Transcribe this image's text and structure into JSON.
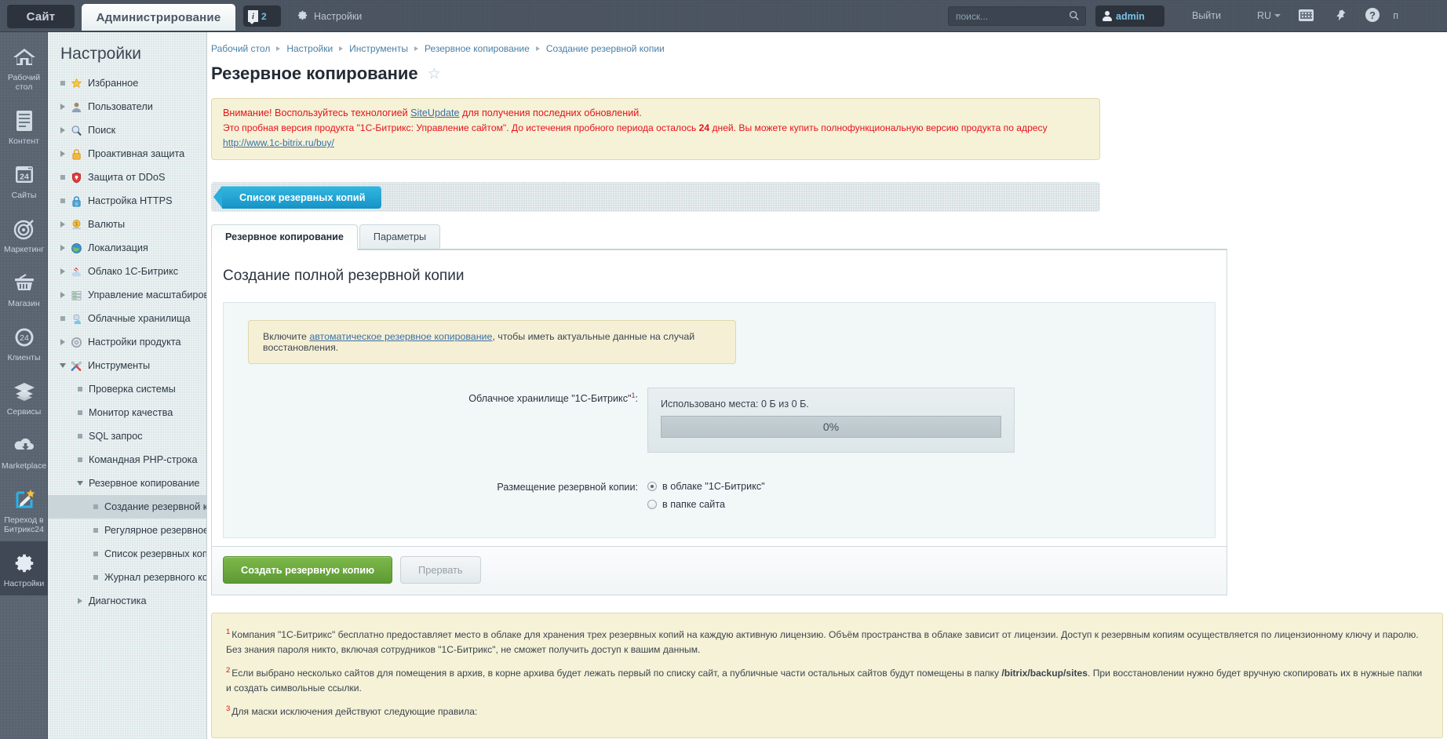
{
  "header": {
    "site_tab": "Сайт",
    "admin_tab": "Администрирование",
    "notification_count": "2",
    "settings_label": "Настройки",
    "search_placeholder": "поиск...",
    "search_value": "",
    "user_name": "admin",
    "logout": "Выйти",
    "language": "RU",
    "help_label": "п"
  },
  "rail": {
    "items": [
      {
        "label": "Рабочий стол",
        "icon": "home-icon"
      },
      {
        "label": "Контент",
        "icon": "document-icon"
      },
      {
        "label": "Сайты",
        "icon": "sites-24-icon"
      },
      {
        "label": "Маркетинг",
        "icon": "target-icon"
      },
      {
        "label": "Магазин",
        "icon": "basket-icon"
      },
      {
        "label": "Клиенты",
        "icon": "clients-24-icon"
      },
      {
        "label": "Сервисы",
        "icon": "layers-icon"
      },
      {
        "label": "Marketplace",
        "icon": "cloud-download-icon"
      },
      {
        "label": "Переход в Битрикс24",
        "icon": "pencil-star-icon"
      },
      {
        "label": "Настройки",
        "icon": "gear-icon"
      }
    ],
    "active_index": 9
  },
  "settings_menu": {
    "title": "Настройки",
    "items": [
      {
        "label": "Избранное",
        "level": 1,
        "twisty": "bullet",
        "icon": "star-icon"
      },
      {
        "label": "Пользователи",
        "level": 1,
        "twisty": "right",
        "icon": "user-icon"
      },
      {
        "label": "Поиск",
        "level": 1,
        "twisty": "right",
        "icon": "magnifier-icon"
      },
      {
        "label": "Проактивная защита",
        "level": 1,
        "twisty": "right",
        "icon": "lock-orange-icon"
      },
      {
        "label": "Защита от DDoS",
        "level": 1,
        "twisty": "bullet",
        "icon": "shield-red-icon"
      },
      {
        "label": "Настройка HTTPS",
        "level": 1,
        "twisty": "bullet",
        "icon": "lock-blue-icon"
      },
      {
        "label": "Валюты",
        "level": 1,
        "twisty": "right",
        "icon": "currency-icon"
      },
      {
        "label": "Локализация",
        "level": 1,
        "twisty": "right",
        "icon": "globe-icon"
      },
      {
        "label": "Облако 1С-Битрикс",
        "level": 1,
        "twisty": "right",
        "icon": "cloud-bitrix-icon"
      },
      {
        "label": "Управление масштабирова",
        "level": 1,
        "twisty": "right",
        "icon": "server-icon"
      },
      {
        "label": "Облачные хранилища",
        "level": 1,
        "twisty": "bullet",
        "icon": "cloud-storage-icon"
      },
      {
        "label": "Настройки продукта",
        "level": 1,
        "twisty": "right",
        "icon": "gear-gray-icon"
      },
      {
        "label": "Инструменты",
        "level": 1,
        "twisty": "down",
        "icon": "tools-icon"
      },
      {
        "label": "Проверка системы",
        "level": 2,
        "twisty": "bullet",
        "icon": ""
      },
      {
        "label": "Монитор качества",
        "level": 2,
        "twisty": "bullet",
        "icon": ""
      },
      {
        "label": "SQL запрос",
        "level": 2,
        "twisty": "bullet",
        "icon": ""
      },
      {
        "label": "Командная PHP-строка",
        "level": 2,
        "twisty": "bullet",
        "icon": ""
      },
      {
        "label": "Резервное копирование",
        "level": 2,
        "twisty": "down",
        "icon": ""
      },
      {
        "label": "Создание резервной ко",
        "level": 3,
        "twisty": "bullet",
        "icon": "",
        "selected": true
      },
      {
        "label": "Регулярное резервное",
        "level": 3,
        "twisty": "bullet",
        "icon": ""
      },
      {
        "label": "Список резервных копи",
        "level": 3,
        "twisty": "bullet",
        "icon": ""
      },
      {
        "label": "Журнал резервного ког",
        "level": 3,
        "twisty": "bullet",
        "icon": ""
      },
      {
        "label": "Диагностика",
        "level": 2,
        "twisty": "right",
        "icon": ""
      }
    ]
  },
  "breadcrumb": [
    "Рабочий стол",
    "Настройки",
    "Инструменты",
    "Резервное копирование",
    "Создание резервной копии"
  ],
  "page": {
    "title": "Резервное копирование",
    "favorite_icon": "star-outline-icon"
  },
  "trial_notice": {
    "line1_prefix": "Внимание! Воспользуйтесь технологией ",
    "line1_link": "SiteUpdate",
    "line1_suffix": " для получения последних обновлений.",
    "line2_prefix": "Это пробная версия продукта \"1С-Битрикс: Управление сайтом\". До истечения пробного периода осталось ",
    "line2_days": "24",
    "line2_mid": " дней. Вы можете купить полнофункциональную версию продукта по адресу ",
    "line2_link": "http://www.1c-bitrix.ru/buy/"
  },
  "toolbar": {
    "list_backups_label": "Список резервных копий"
  },
  "tabs": [
    {
      "label": "Резервное копирование",
      "active": true
    },
    {
      "label": "Параметры",
      "active": false
    }
  ],
  "form": {
    "heading": "Создание полной резервной копии",
    "auto_note_prefix": "Включите ",
    "auto_note_link": "автоматическое резервное копирование",
    "auto_note_suffix": ", чтобы иметь актуальные данные на случай восстановления.",
    "storage_label": "Облачное хранилище \"1С-Битрикс\"",
    "storage_label_sup": "1",
    "storage_label_colon": ":",
    "storage_used": "Использовано места: 0 Б из 0 Б.",
    "progress_percent": "0%",
    "placement_label": "Размещение резервной копии:",
    "placement_options": [
      {
        "label": "в облаке \"1С-Битрикс\"",
        "checked": true
      },
      {
        "label": "в папке сайта",
        "checked": false
      }
    ],
    "create_button": "Создать резервную копию",
    "abort_button": "Прервать"
  },
  "footnotes": [
    {
      "num": "1",
      "text": "Компания \"1С-Битрикс\" бесплатно предоставляет место в облаке для хранения трех резервных копий на каждую активную лицензию. Объём пространства в облаке зависит от лицензии. Доступ к резервным копиям осуществляется по лицензионному ключу и паролю. Без знания пароля никто, включая сотрудников \"1С-Битрикс\", не сможет получить доступ к вашим данным."
    },
    {
      "num": "2",
      "text_before": "Если выбрано несколько сайтов для помещения в архив, в корне архива будет лежать первый по списку сайт, а публичные части остальных сайтов будут помещены в папку ",
      "bold": "/bitrix/backup/sites",
      "text_after": ". При восстановлении нужно будет вручную скопировать их в нужные папки и создать символьные ссылки."
    },
    {
      "num": "3",
      "text": "Для маски исключения действуют следующие правила:"
    }
  ],
  "colors": {
    "accent_blue": "#1593c6",
    "green_button": "#5d9a33",
    "warning_bg": "#f5f2d7",
    "alert_red": "#e8121b",
    "link_blue": "#3a6fa8"
  }
}
